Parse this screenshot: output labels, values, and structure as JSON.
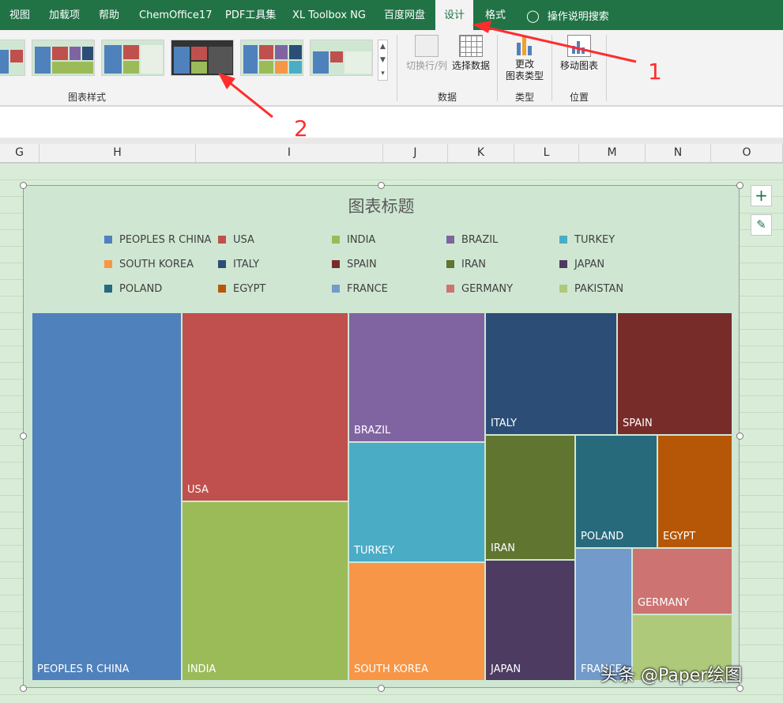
{
  "ribbon_tabs": [
    "视图",
    "加载项",
    "帮助",
    "ChemOffice17",
    "PDF工具集",
    "XL Toolbox NG",
    "百度网盘",
    "设计",
    "格式",
    "操作说明搜索"
  ],
  "ribbon": {
    "group_chart_styles": "图表样式",
    "group_data": "数据",
    "group_type": "类型",
    "group_location": "位置",
    "switch_row_col": "切换行/列",
    "select_data": "选择数据",
    "change_type_line1": "更改",
    "change_type_line2": "图表类型",
    "move_chart": "移动图表"
  },
  "columns": [
    "G",
    "H",
    "I",
    "J",
    "K",
    "L",
    "M",
    "N",
    "O"
  ],
  "annotations": [
    "1",
    "2"
  ],
  "watermark": "头条 @Paper绘图",
  "colors": {
    "accent": "#217346",
    "annotation": "#ff2d2d"
  },
  "chart_data": {
    "type": "treemap",
    "title": "图表标题",
    "legend": [
      {
        "name": "PEOPLES R CHINA",
        "color": "#4f81bd"
      },
      {
        "name": "USA",
        "color": "#c0504d"
      },
      {
        "name": "INDIA",
        "color": "#9bbb59"
      },
      {
        "name": "BRAZIL",
        "color": "#8064a2"
      },
      {
        "name": "TURKEY",
        "color": "#4bacc6"
      },
      {
        "name": "SOUTH KOREA",
        "color": "#f79646"
      },
      {
        "name": "ITALY",
        "color": "#2c4d75"
      },
      {
        "name": "SPAIN",
        "color": "#772c2a"
      },
      {
        "name": "IRAN",
        "color": "#5f7530"
      },
      {
        "name": "JAPAN",
        "color": "#4d3b62"
      },
      {
        "name": "POLAND",
        "color": "#276a7c"
      },
      {
        "name": "EGYPT",
        "color": "#b65708"
      },
      {
        "name": "FRANCE",
        "color": "#729aca"
      },
      {
        "name": "GERMANY",
        "color": "#cd7371"
      },
      {
        "name": "PAKISTAN",
        "color": "#afc97a"
      }
    ],
    "labels": [
      "PEOPLES R CHINA",
      "USA",
      "INDIA",
      "BRAZIL",
      "TURKEY",
      "SOUTH KOREA",
      "ITALY",
      "SPAIN",
      "IRAN",
      "JAPAN",
      "POLAND",
      "EGYPT",
      "FRANCE",
      "GERMANY"
    ]
  }
}
